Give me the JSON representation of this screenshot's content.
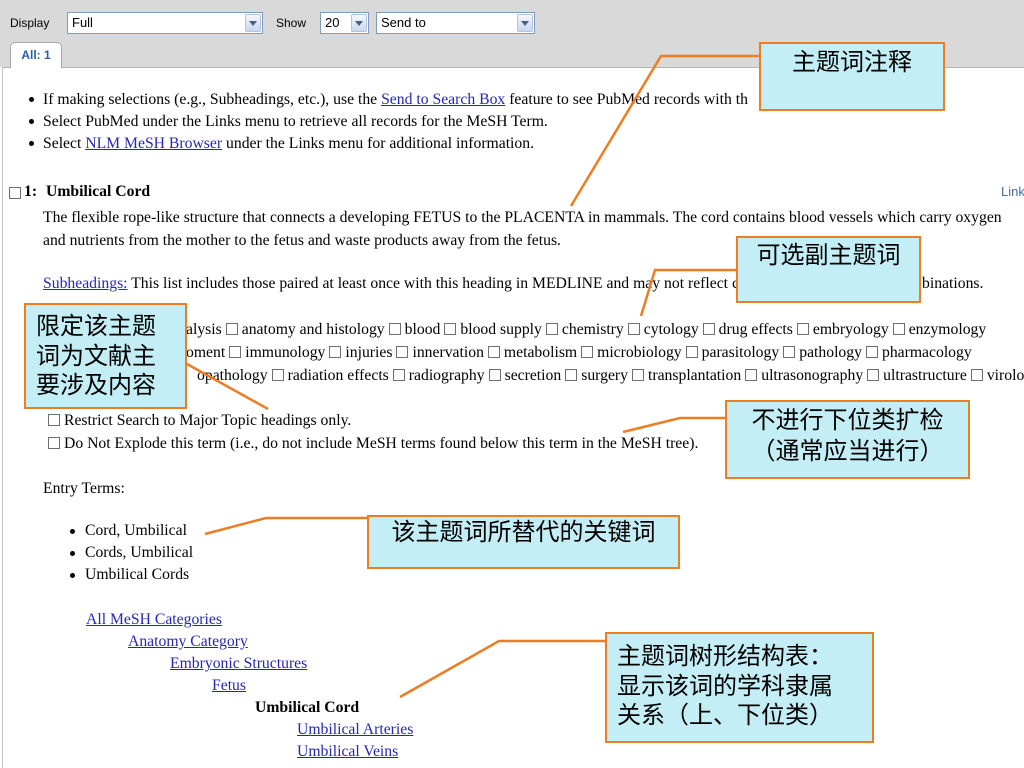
{
  "toolbar": {
    "display_label": "Display",
    "display_value": "Full",
    "show_label": "Show",
    "show_value": "20",
    "send_to_value": "Send to"
  },
  "tab": {
    "label": "All: 1"
  },
  "tips": {
    "t1_pre": "If making selections (e.g., Subheadings, etc.), use the ",
    "t1_link": "Send to Search Box",
    "t1_post": " feature to see PubMed records with th",
    "t2": "Select PubMed under the Links menu to retrieve all records for the MeSH Term.",
    "t3_pre": "Select ",
    "t3_link": "NLM MeSH Browser",
    "t3_post": " under the Links menu for additional information."
  },
  "record": {
    "number": "1:",
    "title": "Umbilical Cord",
    "links_label": "Link",
    "scope_note_1": "The flexible rope-like structure that connects a developing FETUS to the PLACENTA in mammals. The cord contains blood vessels which carry oxygen",
    "scope_note_2": "and nutrients from the mother to the fetus and waste products away from the fetus.",
    "subheadings_link": "Subheadings:",
    "subheadings_note": " This list includes those paired at least once with this heading in MEDLINE and may not reflect c",
    "subheadings_note_tail": "binations.",
    "subheadings": [
      [
        "alysis",
        "anatomy and histology",
        "blood",
        "blood supply",
        "chemistry",
        "cytology",
        "drug effects",
        "embryology",
        "enzymology"
      ],
      [
        "oment",
        "immunology",
        "injuries",
        "innervation",
        "metabolism",
        "microbiology",
        "parasitology",
        "pathology",
        "pharmacology"
      ],
      [
        "opathology",
        "radiation effects",
        "radiography",
        "secretion",
        "surgery",
        "transplantation",
        "ultrasonography",
        "ultrastructure",
        "virolog"
      ]
    ],
    "options": [
      "Restrict Search to Major Topic headings only.",
      "Do Not Explode this term (i.e., do not include MeSH terms found below this term in the MeSH tree)."
    ],
    "entry_terms_label": "Entry Terms:",
    "entry_terms": [
      "Cord, Umbilical",
      "Cords, Umbilical",
      "Umbilical Cords"
    ],
    "tree": [
      "All MeSH Categories",
      "Anatomy Category",
      "Embryonic Structures",
      "Fetus",
      "Umbilical Cord",
      "Umbilical Arteries",
      "Umbilical Veins"
    ]
  },
  "annotations": {
    "scope_note_callout": [
      "主题词注释"
    ],
    "subheadings_callout": [
      "可选副主题词"
    ],
    "major_topic_callout": [
      "限定该主题",
      "词为文献主",
      "要涉及内容"
    ],
    "no_explode_callout": [
      "不进行下位类扩检",
      "（通常应当进行）"
    ],
    "entry_terms_callout": [
      "该主题词所替代的关键词"
    ],
    "tree_callout": [
      "主题词树形结构表：",
      "显示该词的学科隶属",
      "关系（上、下位类）"
    ]
  },
  "colors": {
    "callout_fill": "#c3eef5",
    "callout_border": "#ee7d22",
    "link": "#2626b4",
    "toolbar_bg": "#d9d9d9"
  }
}
